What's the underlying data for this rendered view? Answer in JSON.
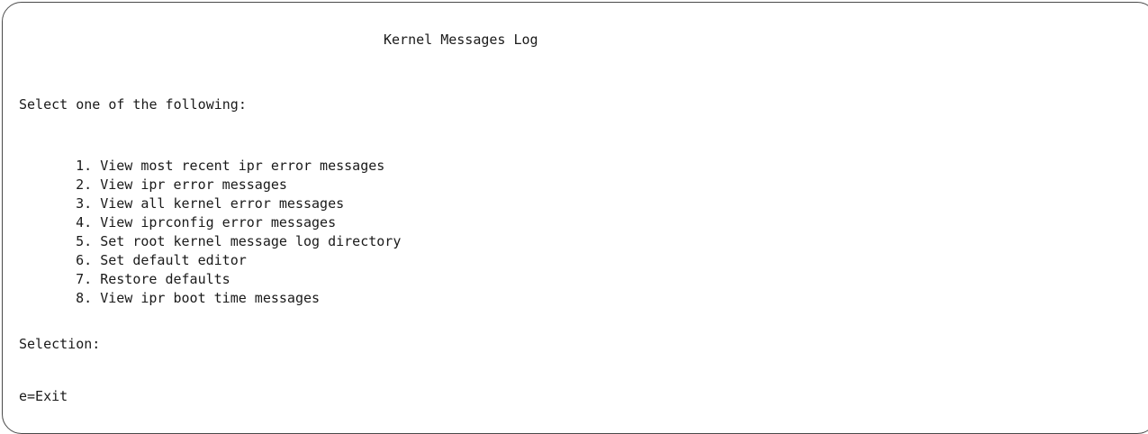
{
  "screen": {
    "title": "Kernel Messages Log",
    "prompt": "Select one of the following:"
  },
  "menu": {
    "items": [
      {
        "number": "1.",
        "label": "View most recent ipr error messages"
      },
      {
        "number": "2.",
        "label": "View ipr error messages"
      },
      {
        "number": "3.",
        "label": "View all kernel error messages"
      },
      {
        "number": "4.",
        "label": "View iprconfig error messages"
      },
      {
        "number": "5.",
        "label": "Set root kernel message log directory"
      },
      {
        "number": "6.",
        "label": "Set default editor"
      },
      {
        "number": "7.",
        "label": "Restore defaults"
      },
      {
        "number": "8.",
        "label": "View ipr boot time messages"
      }
    ]
  },
  "selection": {
    "label": "Selection:",
    "value": ""
  },
  "footer": {
    "exit_key": "e=Exit"
  },
  "colors": {
    "text": "#1a1a1a",
    "frame": "#4a4a4a",
    "background": "#ffffff"
  }
}
